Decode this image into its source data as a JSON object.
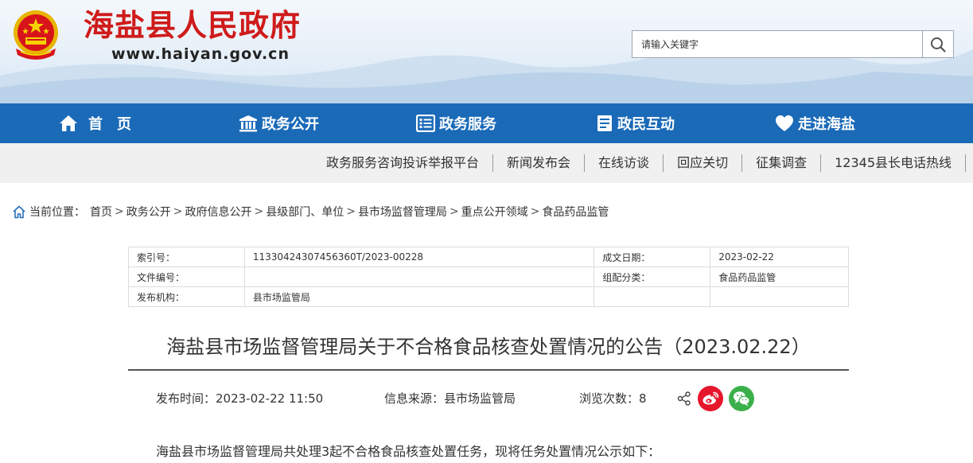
{
  "header": {
    "site_title": "海盐县人民政府",
    "site_domain": "www.haiyan.gov.cn",
    "search_placeholder": "请输入关键字",
    "search_value": ""
  },
  "main_nav": {
    "items": [
      {
        "label": "首　页",
        "icon": "home-icon"
      },
      {
        "label": "政务公开",
        "icon": "building-icon"
      },
      {
        "label": "政务服务",
        "icon": "list-icon"
      },
      {
        "label": "政民互动",
        "icon": "document-icon"
      },
      {
        "label": "走进海盐",
        "icon": "heart-icon"
      }
    ]
  },
  "sub_nav": {
    "items": [
      "政务服务咨询投诉举报平台",
      "新闻发布会",
      "在线访谈",
      "回应关切",
      "征集调查",
      "12345县长电话热线"
    ]
  },
  "breadcrumb": {
    "prefix": "当前位置：",
    "items": [
      "首页",
      "政务公开",
      "政府信息公开",
      "县级部门、单位",
      "县市场监督管理局",
      "重点公开领域",
      "食品药品监管"
    ]
  },
  "info_table": {
    "rows": [
      {
        "label1": "索引号：",
        "value1": "11330424307456360T/2023-00228",
        "label2": "成文日期：",
        "value2": "2023-02-22"
      },
      {
        "label1": "文件编号：",
        "value1": "",
        "label2": "组配分类：",
        "value2": "食品药品监管"
      },
      {
        "label1": "发布机构：",
        "value1": "县市场监管局",
        "label2": "",
        "value2": ""
      }
    ]
  },
  "article": {
    "title": "海盐县市场监督管理局关于不合格食品核查处置情况的公告（2023.02.22）",
    "publish_time": "发布时间：2023-02-22 11:50",
    "source": "信息来源：县市场监管局",
    "views": "浏览次数：8",
    "intro": "海盐县市场监督管理局共处理3起不合格食品核查处置任务，现将任务处置情况公示如下："
  },
  "colors": {
    "nav_blue": "#1a6ab8",
    "title_red": "#cf1b1b",
    "weibo_red": "#e6162d",
    "wechat_green": "#3bb04a"
  }
}
